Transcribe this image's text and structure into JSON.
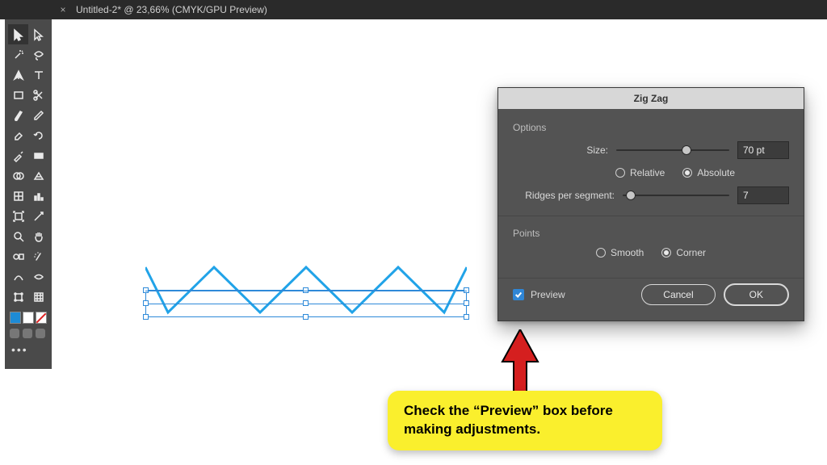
{
  "tabbar": {
    "close": "×",
    "title": "Untitled-2* @ 23,66% (CMYK/GPU Preview)"
  },
  "tools": [
    "selection-tool",
    "direct-selection-tool",
    "magic-wand-tool",
    "lasso-tool",
    "pen-tool",
    "type-tool",
    "rectangle-tool",
    "scissors-tool",
    "paintbrush-tool",
    "pencil-tool",
    "eraser-tool",
    "rotate-tool",
    "eyedropper-tool",
    "gradient-tool",
    "shape-builder-tool",
    "perspective-tool",
    "mesh-tool",
    "column-graph-tool",
    "artboard-tool",
    "slice-tool",
    "zoom-tool",
    "hand-tool",
    "blend-tool",
    "symbol-sprayer-tool",
    "curvature-tool",
    "width-tool",
    "free-transform-tool",
    "grid-tool"
  ],
  "dialog": {
    "title": "Zig Zag",
    "options_label": "Options",
    "size_label": "Size:",
    "size_value": "70 pt",
    "size_knob_pct": 58,
    "relative_label": "Relative",
    "absolute_label": "Absolute",
    "size_mode": "absolute",
    "ridges_label": "Ridges per segment:",
    "ridges_value": "7",
    "ridges_knob_pct": 3,
    "points_label": "Points",
    "smooth_label": "Smooth",
    "corner_label": "Corner",
    "points_mode": "corner",
    "preview_label": "Preview",
    "preview_checked": true,
    "cancel": "Cancel",
    "ok": "OK"
  },
  "callout": {
    "text": "Check the “Preview” box before making adjustments."
  }
}
